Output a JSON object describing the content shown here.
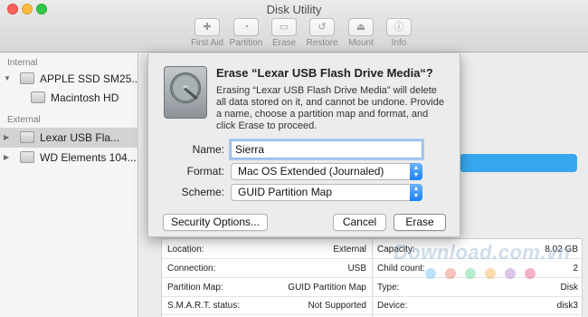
{
  "window": {
    "title": "Disk Utility"
  },
  "toolbar": {
    "items": [
      {
        "label": "First Aid",
        "icon": "stethoscope-icon",
        "glyph": "✚"
      },
      {
        "label": "Partition",
        "icon": "partition-icon",
        "glyph": "◔"
      },
      {
        "label": "Erase",
        "icon": "erase-icon",
        "glyph": "▭"
      },
      {
        "label": "Restore",
        "icon": "restore-icon",
        "glyph": "↺"
      },
      {
        "label": "Mount",
        "icon": "mount-icon",
        "glyph": "⏏"
      },
      {
        "label": "Info",
        "icon": "info-icon",
        "glyph": "ⓘ"
      }
    ]
  },
  "sidebar": {
    "internal_header": "Internal",
    "external_header": "External",
    "items": [
      {
        "label": "APPLE SSD SM25..."
      },
      {
        "label": "Macintosh HD"
      },
      {
        "label": "Lexar USB Fla..."
      },
      {
        "label": "WD Elements 104..."
      }
    ]
  },
  "dialog": {
    "title": "Erase “Lexar USB Flash Drive Media“?",
    "message": "Erasing “Lexar USB Flash Drive Media” will delete all data stored on it, and cannot be undone. Provide a name, choose a partition map and format, and click Erase to proceed.",
    "name_label": "Name:",
    "name_value": "Sierra",
    "format_label": "Format:",
    "format_value": "Mac OS Extended (Journaled)",
    "scheme_label": "Scheme:",
    "scheme_value": "GUID Partition Map",
    "security_button": "Security Options...",
    "cancel_button": "Cancel",
    "erase_button": "Erase"
  },
  "info": {
    "rows": [
      {
        "left_key": "Location:",
        "left_val": "External",
        "right_key": "Capacity:",
        "right_val": "8.02 GB"
      },
      {
        "left_key": "Connection:",
        "left_val": "USB",
        "right_key": "Child count:",
        "right_val": "2"
      },
      {
        "left_key": "Partition Map:",
        "left_val": "GUID Partition Map",
        "right_key": "Type:",
        "right_val": "Disk"
      },
      {
        "left_key": "S.M.A.R.T. status:",
        "left_val": "Not Supported",
        "right_key": "Device:",
        "right_val": "disk3"
      }
    ]
  },
  "watermark": "Download.com.vn",
  "colors": {
    "accent": "#1a82fb",
    "selection": "#d3d3d3",
    "progress": "#36a7ee"
  }
}
